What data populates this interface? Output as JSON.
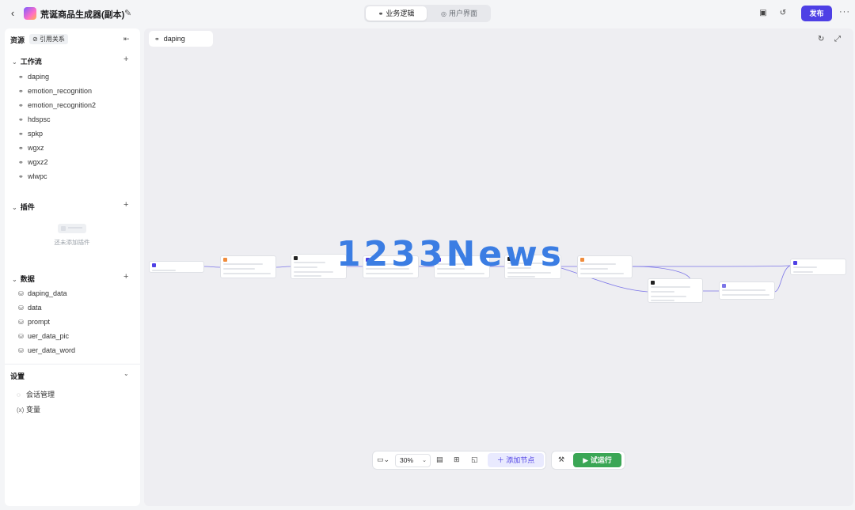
{
  "header": {
    "title": "荒诞商品生成器(副本)",
    "tabs": [
      {
        "label": "业务逻辑",
        "icon": "workflow-icon",
        "active": true
      },
      {
        "label": "用户界面",
        "icon": "palette-icon",
        "active": false
      }
    ],
    "publish_label": "发布"
  },
  "sidebar": {
    "tab_resources": "资源",
    "tab_references": "引用关系",
    "workflows": {
      "title": "工作流",
      "items": [
        "daping",
        "emotion_recognition",
        "emotion_recognition2",
        "hdspsc",
        "spkp",
        "wgxz",
        "wgxz2",
        "wlwpc"
      ]
    },
    "plugins": {
      "title": "插件",
      "empty_text": "还未添加插件"
    },
    "data": {
      "title": "数据",
      "items": [
        "daping_data",
        "data",
        "prompt",
        "uer_data_pic",
        "uer_data_word"
      ]
    },
    "settings": {
      "title": "设置",
      "items": [
        {
          "label": "会话管理",
          "icon": "chat-icon"
        },
        {
          "label": "变量",
          "icon": "variable-icon"
        }
      ]
    }
  },
  "canvas": {
    "workflow_tab": "daping",
    "watermark": "1233News"
  },
  "toolbar": {
    "zoom": "30%",
    "add_node_label": "添加节点",
    "run_label": "试运行"
  },
  "colors": {
    "accent": "#4e40e5",
    "run": "#3aa655",
    "edge": "#7b74e8"
  }
}
